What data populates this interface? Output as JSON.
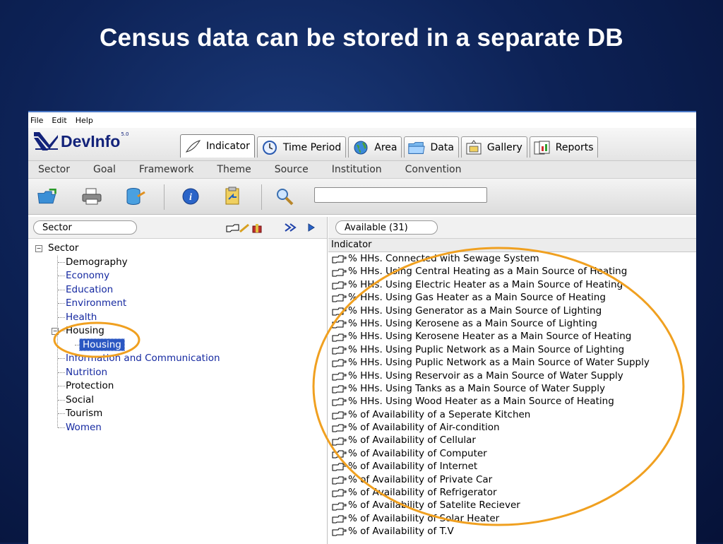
{
  "slide": {
    "title": "Census data can be stored in a separate DB"
  },
  "menu": [
    "File",
    "Edit",
    "Help"
  ],
  "brand": {
    "name": "DevInfo",
    "version": "5.0"
  },
  "tabs": [
    {
      "label": "Indicator",
      "icon": "indicator-quill-icon",
      "active": true
    },
    {
      "label": "Time Period",
      "icon": "clock-icon",
      "active": false
    },
    {
      "label": "Area",
      "icon": "globe-icon",
      "active": false
    },
    {
      "label": "Data",
      "icon": "folder-icon",
      "active": false
    },
    {
      "label": "Gallery",
      "icon": "gallery-icon",
      "active": false
    },
    {
      "label": "Reports",
      "icon": "reports-icon",
      "active": false
    }
  ],
  "categories": [
    "Sector",
    "Goal",
    "Framework",
    "Theme",
    "Source",
    "Institution",
    "Convention"
  ],
  "toolbar": {
    "icons": [
      "open-folder-icon",
      "print-icon",
      "database-export-icon",
      "info-icon",
      "clipboard-icon",
      "search-icon"
    ],
    "search_value": ""
  },
  "left": {
    "selector": "Sector",
    "tree": {
      "root": "Sector",
      "items": [
        {
          "label": "Demography",
          "color": "black"
        },
        {
          "label": "Economy",
          "color": "blue"
        },
        {
          "label": "Education",
          "color": "blue"
        },
        {
          "label": "Environment",
          "color": "blue"
        },
        {
          "label": "Health",
          "color": "blue"
        },
        {
          "label": "Housing",
          "color": "black",
          "expanded": true,
          "children": [
            {
              "label": "Housing",
              "selected": true
            }
          ]
        },
        {
          "label": "Information and Communication",
          "color": "blue"
        },
        {
          "label": "Nutrition",
          "color": "blue"
        },
        {
          "label": "Protection",
          "color": "black"
        },
        {
          "label": "Social",
          "color": "black"
        },
        {
          "label": "Tourism",
          "color": "black"
        },
        {
          "label": "Women",
          "color": "blue"
        }
      ]
    }
  },
  "right": {
    "available": "Available (31)",
    "column_header": "Indicator",
    "indicators": [
      "% HHs. Connected with Sewage System",
      "% HHs. Using Central Heating as a Main Source of Heating",
      "% HHs. Using Electric Heater as a Main Source of Heating",
      "% HHs. Using Gas Heater as a Main Source of Heating",
      "% HHs. Using Generator as a Main Source of Lighting",
      "% HHs. Using Kerosene as a Main Source of Lighting",
      "% HHs. Using Kerosene Heater as a Main Source of Heating",
      "% HHs. Using Puplic Network as a Main Source of Lighting",
      "% HHs. Using Puplic Network as a Main Source of Water Supply",
      "% HHs. Using Reservoir as a Main Source of Water Supply",
      "% HHs. Using Tanks as a Main Source of Water Supply",
      "% HHs. Using Wood Heater as a Main Source of Heating",
      "% of Availability of a Seperate Kitchen",
      "% of Availability of Air-condition",
      "% of Availability of Cellular",
      "% of Availability of Computer",
      "% of Availability of Internet",
      "% of Availability of Private Car",
      "% of Availability of Refrigerator",
      "% of Availability of Satelite Reciever",
      "% of Availability of Solar Heater",
      "% of Availability of T.V"
    ]
  },
  "colors": {
    "highlight": "#f0a020",
    "selection": "#2b57c2",
    "tree_link": "#1428a0",
    "slide_bg": "#0d2256"
  }
}
